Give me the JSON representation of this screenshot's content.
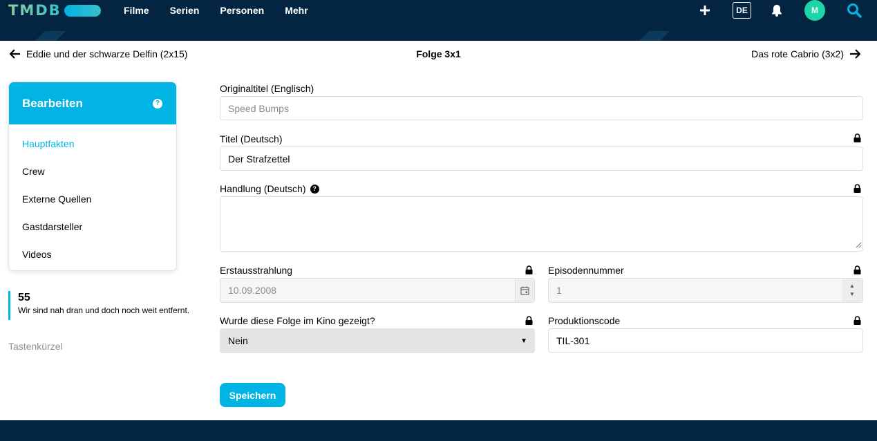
{
  "header": {
    "logo": "TMDB",
    "nav": [
      "Filme",
      "Serien",
      "Personen",
      "Mehr"
    ],
    "language": "DE",
    "avatar_initial": "M",
    "colors": {
      "bg": "#032541",
      "accent": "#01b4e4",
      "avatar": "#1ed5a9"
    },
    "icons": [
      "plus-icon",
      "bell-icon",
      "search-icon"
    ]
  },
  "episode_nav": {
    "prev": "Eddie und der schwarze Delfin (2x15)",
    "current": "Folge 3x1",
    "next": "Das rote Cabrio (3x2)"
  },
  "sidebar": {
    "title": "Bearbeiten",
    "items": [
      {
        "label": "Hauptfakten",
        "active": true
      },
      {
        "label": "Crew"
      },
      {
        "label": "Externe Quellen"
      },
      {
        "label": "Gastdarsteller"
      },
      {
        "label": "Videos"
      }
    ],
    "progress_number": "55",
    "progress_text": "Wir sind nah dran und doch noch weit entfernt.",
    "shortcuts": "Tastenkürzel"
  },
  "form": {
    "original_title": {
      "label": "Originaltitel (Englisch)",
      "placeholder": "Speed Bumps"
    },
    "title": {
      "label": "Titel (Deutsch)",
      "value": "Der Strafzettel"
    },
    "overview": {
      "label": "Handlung (Deutsch)",
      "value": ""
    },
    "air_date": {
      "label": "Erstausstrahlung",
      "value": "10.09.2008"
    },
    "episode_number": {
      "label": "Episodennummer",
      "value": "1"
    },
    "in_cinema": {
      "label": "Wurde diese Folge im Kino gezeigt?",
      "value": "Nein"
    },
    "production_code": {
      "label": "Produktionscode",
      "value": "TIL-301"
    },
    "save_label": "Speichern"
  }
}
